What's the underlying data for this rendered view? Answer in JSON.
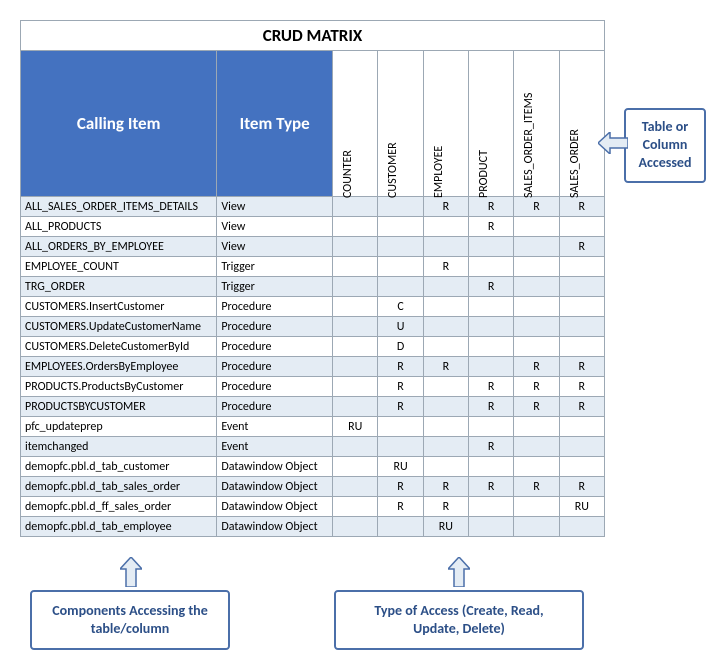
{
  "title": "CRUD MATRIX",
  "headers": {
    "calling_item": "Calling Item",
    "item_type": "Item Type"
  },
  "columns": [
    "COUNTER",
    "CUSTOMER",
    "EMPLOYEE",
    "PRODUCT",
    "SALES_ORDER_ITEMS",
    "SALES_ORDER"
  ],
  "rows": [
    {
      "calling": "ALL_SALES_ORDER_ITEMS_DETAILS",
      "type": "View",
      "v": [
        "",
        "",
        "R",
        "R",
        "R",
        "R"
      ]
    },
    {
      "calling": "ALL_PRODUCTS",
      "type": "View",
      "v": [
        "",
        "",
        "",
        "R",
        "",
        ""
      ]
    },
    {
      "calling": "ALL_ORDERS_BY_EMPLOYEE",
      "type": "View",
      "v": [
        "",
        "",
        "",
        "",
        "",
        "R"
      ]
    },
    {
      "calling": "EMPLOYEE_COUNT",
      "type": "Trigger",
      "v": [
        "",
        "",
        "R",
        "",
        "",
        ""
      ]
    },
    {
      "calling": "TRG_ORDER",
      "type": "Trigger",
      "v": [
        "",
        "",
        "",
        "R",
        "",
        ""
      ]
    },
    {
      "calling": "CUSTOMERS.InsertCustomer",
      "type": "Procedure",
      "v": [
        "",
        "C",
        "",
        "",
        "",
        ""
      ]
    },
    {
      "calling": "CUSTOMERS.UpdateCustomerName",
      "type": "Procedure",
      "v": [
        "",
        "U",
        "",
        "",
        "",
        ""
      ]
    },
    {
      "calling": "CUSTOMERS.DeleteCustomerById",
      "type": "Procedure",
      "v": [
        "",
        "D",
        "",
        "",
        "",
        ""
      ]
    },
    {
      "calling": "EMPLOYEES.OrdersByEmployee",
      "type": "Procedure",
      "v": [
        "",
        "R",
        "R",
        "",
        "R",
        "R"
      ]
    },
    {
      "calling": "PRODUCTS.ProductsByCustomer",
      "type": "Procedure",
      "v": [
        "",
        "R",
        "",
        "R",
        "R",
        "R"
      ]
    },
    {
      "calling": "PRODUCTSBYCUSTOMER",
      "type": "Procedure",
      "v": [
        "",
        "R",
        "",
        "R",
        "R",
        "R"
      ]
    },
    {
      "calling": "pfc_updateprep",
      "type": "Event",
      "v": [
        "RU",
        "",
        "",
        "",
        "",
        ""
      ]
    },
    {
      "calling": "itemchanged",
      "type": "Event",
      "v": [
        "",
        "",
        "",
        "R",
        "",
        ""
      ]
    },
    {
      "calling": "demopfc.pbl.d_tab_customer",
      "type": "Datawindow Object",
      "v": [
        "",
        "RU",
        "",
        "",
        "",
        ""
      ]
    },
    {
      "calling": "demopfc.pbl.d_tab_sales_order",
      "type": "Datawindow Object",
      "v": [
        "",
        "R",
        "R",
        "R",
        "R",
        "R"
      ]
    },
    {
      "calling": "demopfc.pbl.d_ff_sales_order",
      "type": "Datawindow Object",
      "v": [
        "",
        "R",
        "R",
        "",
        "",
        "RU"
      ]
    },
    {
      "calling": "demopfc.pbl.d_tab_employee",
      "type": "Datawindow Object",
      "v": [
        "",
        "",
        "RU",
        "",
        "",
        ""
      ]
    }
  ],
  "callouts": {
    "right": "Table or Column Accessed",
    "bottom_left": "Components Accessing the table/column",
    "bottom_right": "Type of Access (Create, Read, Update, Delete)"
  }
}
